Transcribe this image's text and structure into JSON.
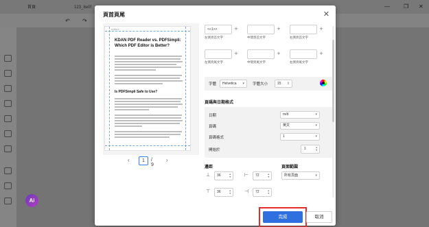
{
  "app": {
    "tabs": [
      "首頁",
      "123_8e0f"
    ],
    "more_label": "更多",
    "ai_label": "Ai"
  },
  "dialog": {
    "title": "頁首頁尾",
    "preview": {
      "header_mark": "<<1>>",
      "doc_title": "KDAN PDF Reader vs. PDFSimpli: Which PDF Editor is Better?",
      "doc_heading2": "Is PDFSimpli Safe to Use?",
      "current_page": "1",
      "total_pages": "/ 9"
    },
    "header": {
      "left_value": "<<1>>",
      "left_label": "左側頁首文字",
      "center_label": "中間頁首文字",
      "right_label": "右側頁首文字"
    },
    "footer": {
      "left_label": "左側頁尾文字",
      "center_label": "中間頁尾文字",
      "right_label": "右側頁尾文字"
    },
    "font": {
      "font_label": "字體",
      "font_value": "Helvetica",
      "size_label": "字體大小",
      "size_value": "15"
    },
    "format": {
      "section_title": "頁碼與日期格式",
      "date_label": "日期",
      "date_value": "m/d",
      "page_label": "頁碼",
      "page_value": "英文",
      "start_format_label": "頁碼格式",
      "start_format_value": "1",
      "start_at_label": "開始於",
      "start_at_value": "1"
    },
    "margins": {
      "section_title": "邊距",
      "top": "36",
      "left_top": "72",
      "bottom": "36",
      "right_bottom": "72"
    },
    "page_range": {
      "section_title": "頁面範圍",
      "value": "所有頁面"
    },
    "buttons": {
      "done": "完成",
      "cancel": "取消"
    }
  }
}
